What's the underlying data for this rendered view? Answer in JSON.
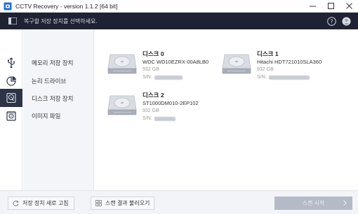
{
  "window": {
    "title": "CCTV Recovery - version 1.1.2 [64 bit]",
    "controls": [
      "minimize",
      "maximize",
      "close"
    ]
  },
  "header": {
    "instruction": "복구할 저장 장치를 선택하세요.",
    "icons": [
      "menu-icon",
      "help-icon",
      "user-icon"
    ]
  },
  "sidebar": {
    "icons": [
      "usb-icon",
      "partition-icon",
      "disk-icon",
      "image-file-icon"
    ],
    "active_index": 2,
    "items": [
      {
        "label": "메모리 저장 장치"
      },
      {
        "label": "논리 드라이브"
      },
      {
        "label": "디스크 저장 장치"
      },
      {
        "label": "이미지 파일"
      }
    ]
  },
  "disks": [
    {
      "name": "디스크 0",
      "model": "WDC WD10EZRX-00A8LB0",
      "size": "932 GB",
      "sn_label": "S/N:"
    },
    {
      "name": "디스크 1",
      "model": "Hitachi HDT721010SLA360",
      "size": "932 GB",
      "sn_label": "S/N:"
    },
    {
      "name": "디스크 2",
      "model": "ST1000DM010-2EP102",
      "size": "932 GB",
      "sn_label": "S/N:"
    }
  ],
  "footer": {
    "refresh_label": "저장 장치 새로 고침",
    "load_scan_label": "스캔 결과 불러오기",
    "start_scan_label": "스캔 시작"
  },
  "colors": {
    "header_bg": "#1e2232",
    "active_icon_bg": "#2d3446",
    "scan_button_disabled": "#b4bac6"
  }
}
